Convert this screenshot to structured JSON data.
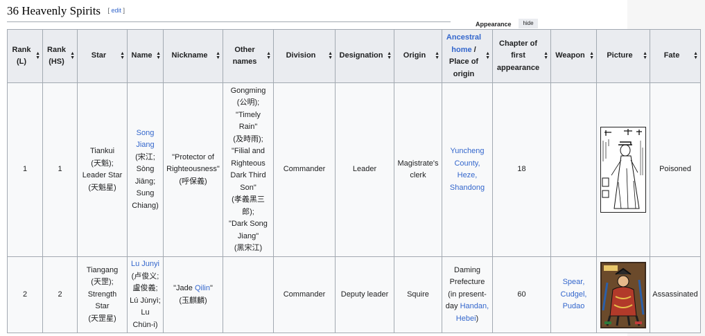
{
  "section": {
    "title": "36 Heavenly Spirits",
    "edit_open": "[ ",
    "edit_label": "edit",
    "edit_close": " ]"
  },
  "appearance": {
    "label": "Appearance",
    "hide_label": "hide"
  },
  "headers": [
    {
      "key": "rank_l",
      "lines": [
        "Rank",
        "(L)"
      ]
    },
    {
      "key": "rank_hs",
      "lines": [
        "Rank",
        "(HS)"
      ]
    },
    {
      "key": "star",
      "lines": [
        "Star"
      ]
    },
    {
      "key": "name",
      "lines": [
        "Name"
      ]
    },
    {
      "key": "nickname",
      "lines": [
        "Nickname"
      ]
    },
    {
      "key": "other_names",
      "lines": [
        "Other",
        "names"
      ]
    },
    {
      "key": "division",
      "lines": [
        "Division"
      ]
    },
    {
      "key": "designation",
      "lines": [
        "Designation"
      ]
    },
    {
      "key": "origin",
      "lines": [
        "Origin"
      ]
    },
    {
      "key": "home",
      "link": "Ancestral home",
      "rest": " /",
      "lines": [
        "Place of",
        "origin"
      ]
    },
    {
      "key": "chapter",
      "lines": [
        "Chapter of",
        "first",
        "appearance"
      ]
    },
    {
      "key": "weapon",
      "lines": [
        "Weapon"
      ]
    },
    {
      "key": "picture",
      "lines": [
        "Picture"
      ]
    },
    {
      "key": "fate",
      "lines": [
        "Fate"
      ]
    }
  ],
  "rows": [
    {
      "rank_l": "1",
      "rank_hs": "1",
      "star": [
        "Tiankui",
        "(天魁);",
        "Leader Star",
        "(天魁星)"
      ],
      "name_link": [
        "Song",
        "Jiang"
      ],
      "name_rest": [
        "(宋江;",
        "Sòng",
        "Jiāng;",
        "Sung",
        "Chiang)"
      ],
      "nickname": [
        "\"Protector of",
        "Righteousness\"",
        "(呼保義)"
      ],
      "other_names": [
        "Gongming",
        "(公明);",
        "\"Timely",
        "Rain\"",
        "(及時雨);",
        "\"Filial and",
        "Righteous",
        "Dark Third",
        "Son\"",
        "(孝義黑三",
        "郎);",
        "\"Dark Song",
        "Jiang\"",
        "(黑宋江)"
      ],
      "division": "Commander",
      "designation": "Leader",
      "origin": [
        "Magistrate's",
        "clerk"
      ],
      "home": [
        {
          "t": "Yuncheng",
          "l": true
        },
        {
          "t": "County,",
          "l": true
        },
        {
          "t": "Heze,",
          "l": true
        },
        {
          "t": "Shandong",
          "l": true
        }
      ],
      "chapter": "18",
      "weapon": [],
      "picture": "woodblock-portrait",
      "fate": "Poisoned"
    },
    {
      "rank_l": "2",
      "rank_hs": "2",
      "star": [
        "Tiangang",
        "(天罡);",
        "Strength",
        "Star",
        "(天罡星)"
      ],
      "name_link": [
        "Lu Junyi"
      ],
      "name_rest": [
        "(卢俊义;",
        "盧俊義;",
        "Lú Jùnyì;",
        "Lu",
        "Chün-i)"
      ],
      "nickname_pre": "\"Jade ",
      "nickname_link": "Qilin",
      "nickname_post": "\"",
      "nickname2": "(玉麒麟)",
      "other_names": [],
      "division": "Commander",
      "designation": "Deputy leader",
      "origin": [
        "Squire"
      ],
      "home": [
        {
          "t": "Daming",
          "l": false
        },
        {
          "t": "Prefecture",
          "l": false
        },
        {
          "t": "(in present-",
          "l": false
        },
        {
          "t": "day ",
          "l": false,
          "join": "Handan,"
        },
        {
          "t": "Hebei",
          "l": true,
          "suffix": ")"
        }
      ],
      "chapter": "60",
      "weapon": [
        "Spear,",
        "Cudgel,",
        "Pudao"
      ],
      "picture": "colour-print-portrait",
      "fate": "Assassinated"
    }
  ]
}
